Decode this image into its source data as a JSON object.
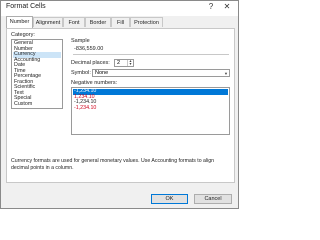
{
  "window": {
    "title": "Format Cells",
    "help": "?",
    "close": "✕"
  },
  "tabs": [
    {
      "label": "Number",
      "active": true
    },
    {
      "label": "Alignment"
    },
    {
      "label": "Font"
    },
    {
      "label": "Border"
    },
    {
      "label": "Fill"
    },
    {
      "label": "Protection"
    }
  ],
  "category": {
    "label": "Category:",
    "items": [
      "General",
      "Number",
      "Currency",
      "Accounting",
      "Date",
      "Time",
      "Percentage",
      "Fraction",
      "Scientific",
      "Text",
      "Special",
      "Custom"
    ],
    "selected_index": 2
  },
  "sample": {
    "label": "Sample",
    "value": "-836,559.00"
  },
  "decimal_places": {
    "label": "Decimal places:",
    "value": "2"
  },
  "symbol": {
    "label": "Symbol:",
    "value": "None"
  },
  "negative_numbers": {
    "label": "Negative numbers:",
    "items": [
      {
        "text": "-1,234.10",
        "red": false
      },
      {
        "text": "1,234.10",
        "red": true
      },
      {
        "text": "-1,234.10",
        "red": false
      },
      {
        "text": "-1,234.10",
        "red": true
      }
    ],
    "selected_index": 0
  },
  "description": "Currency formats are used for general monetary values.  Use Accounting formats to align decimal points in a column.",
  "buttons": {
    "ok": "OK",
    "cancel": "Cancel"
  }
}
